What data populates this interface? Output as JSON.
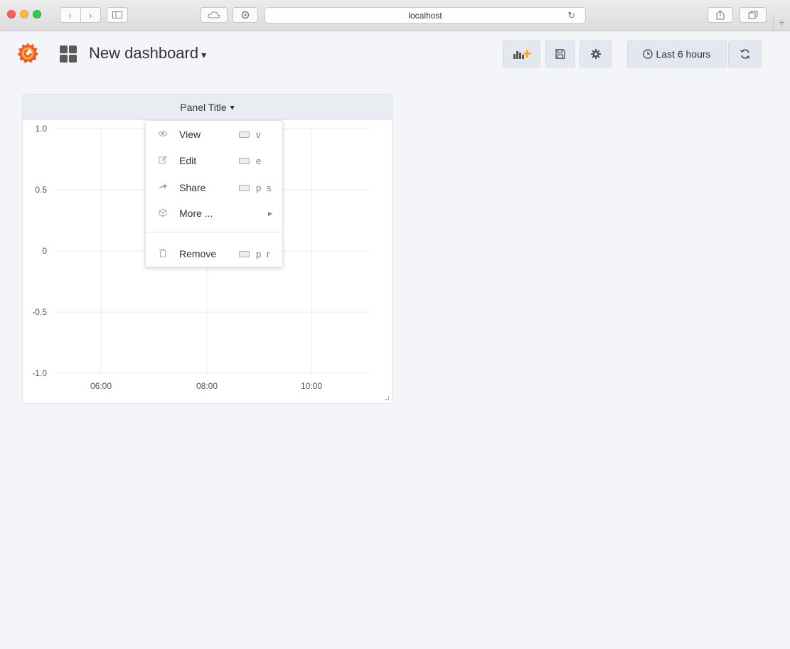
{
  "browser": {
    "address": "localhost",
    "reload_glyph": "↻",
    "back_glyph": "‹",
    "forward_glyph": "›",
    "new_tab_glyph": "+"
  },
  "navbar": {
    "dashboard_title": "New dashboard",
    "caret": "▾",
    "time_range_label": "Last 6 hours",
    "accent_color": "#f05a28"
  },
  "panel": {
    "title": "Panel Title",
    "caret": "▾"
  },
  "menu": {
    "items": [
      {
        "label": "View",
        "icon": "eye-icon",
        "shortcut": "v"
      },
      {
        "label": "Edit",
        "icon": "edit-icon",
        "shortcut": "e"
      },
      {
        "label": "Share",
        "icon": "share-icon",
        "shortcut": "p s"
      },
      {
        "label": "More ...",
        "icon": "cube-icon",
        "submenu": true
      },
      {
        "label": "Remove",
        "icon": "trash-icon",
        "shortcut": "p r"
      }
    ]
  },
  "chart_data": {
    "type": "line",
    "x_ticks": [
      "06:00",
      "08:00",
      "10:00"
    ],
    "y_ticks": [
      "1.0",
      "0.5",
      "0",
      "-0.5",
      "-1.0"
    ],
    "ylim": [
      -1,
      1
    ],
    "series": [],
    "grid": true
  }
}
